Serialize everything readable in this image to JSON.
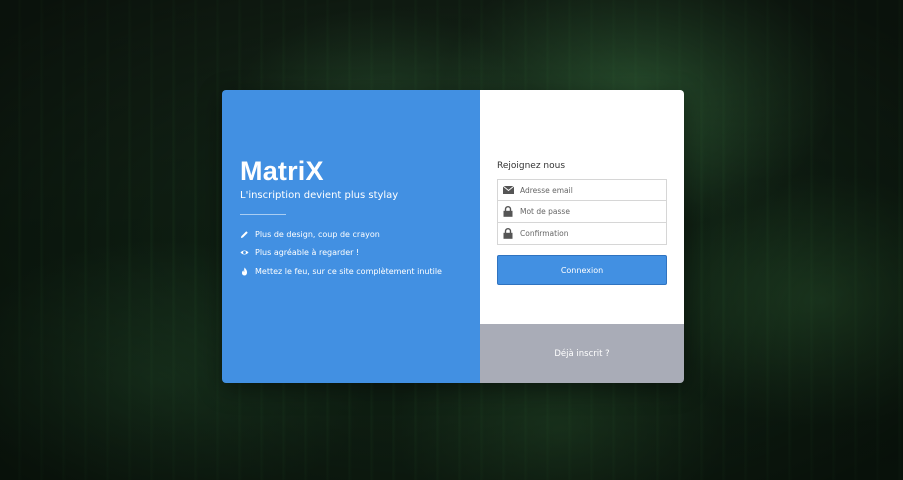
{
  "brand": {
    "title": "MatriX",
    "tagline": "L'inscription devient plus stylay"
  },
  "features": [
    {
      "icon": "pencil-icon",
      "label": "Plus de design, coup de crayon"
    },
    {
      "icon": "eye-icon",
      "label": "Plus agréable à regarder !"
    },
    {
      "icon": "fire-icon",
      "label": "Mettez le feu, sur ce site complètement inutile"
    }
  ],
  "form": {
    "title": "Rejoignez nous",
    "email_placeholder": "Adresse email",
    "password_placeholder": "Mot de passe",
    "confirm_placeholder": "Confirmation",
    "submit_label": "Connexion"
  },
  "footer": {
    "already_label": "Déjà inscrit ?"
  },
  "colors": {
    "accent": "#4290e2",
    "footer_bg": "#a9acb7",
    "form_bg": "#ffffff"
  }
}
